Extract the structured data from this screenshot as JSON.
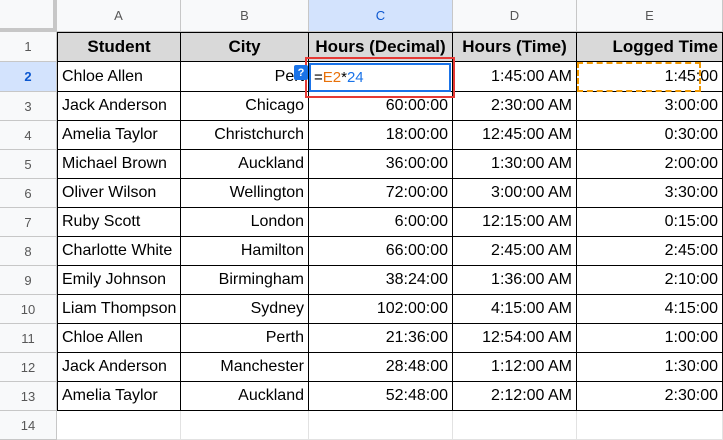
{
  "columns": [
    "A",
    "B",
    "C",
    "D",
    "E"
  ],
  "rows": [
    "1",
    "2",
    "3",
    "4",
    "5",
    "6",
    "7",
    "8",
    "9",
    "10",
    "11",
    "12",
    "13",
    "14"
  ],
  "headers": [
    "Student",
    "City",
    "Hours (Decimal)",
    "Hours (Time)",
    "Logged Time"
  ],
  "data": [
    [
      "Chloe Allen",
      "Pert",
      "",
      "1:45:00 AM",
      "1:45:00"
    ],
    [
      "Jack Anderson",
      "Chicago",
      "60:00:00",
      "2:30:00 AM",
      "3:00:00"
    ],
    [
      "Amelia Taylor",
      "Christchurch",
      "18:00:00",
      "12:45:00 AM",
      "0:30:00"
    ],
    [
      "Michael Brown",
      "Auckland",
      "36:00:00",
      "1:30:00 AM",
      "2:00:00"
    ],
    [
      "Oliver Wilson",
      "Wellington",
      "72:00:00",
      "3:00:00 AM",
      "3:30:00"
    ],
    [
      "Ruby Scott",
      "London",
      "6:00:00",
      "12:15:00 AM",
      "0:15:00"
    ],
    [
      "Charlotte White",
      "Hamilton",
      "66:00:00",
      "2:45:00 AM",
      "2:45:00"
    ],
    [
      "Emily Johnson",
      "Birmingham",
      "38:24:00",
      "1:36:00 AM",
      "2:10:00"
    ],
    [
      "Liam Thompson",
      "Sydney",
      "102:00:00",
      "4:15:00 AM",
      "4:15:00"
    ],
    [
      "Chloe Allen",
      "Perth",
      "21:36:00",
      "12:54:00 AM",
      "1:00:00"
    ],
    [
      "Jack Anderson",
      "Manchester",
      "28:48:00",
      "1:12:00 AM",
      "1:30:00"
    ],
    [
      "Amelia Taylor",
      "Auckland",
      "52:48:00",
      "2:12:00 AM",
      "2:30:00"
    ]
  ],
  "editor": {
    "eq": "=",
    "ref": "E2",
    "op": "*",
    "num": "24"
  },
  "hint_label": "?",
  "colors": {
    "selected_header": "#d3e3fd",
    "accent": "#1a73e8",
    "ref": "#e8710a",
    "highlight": "#e53935"
  }
}
